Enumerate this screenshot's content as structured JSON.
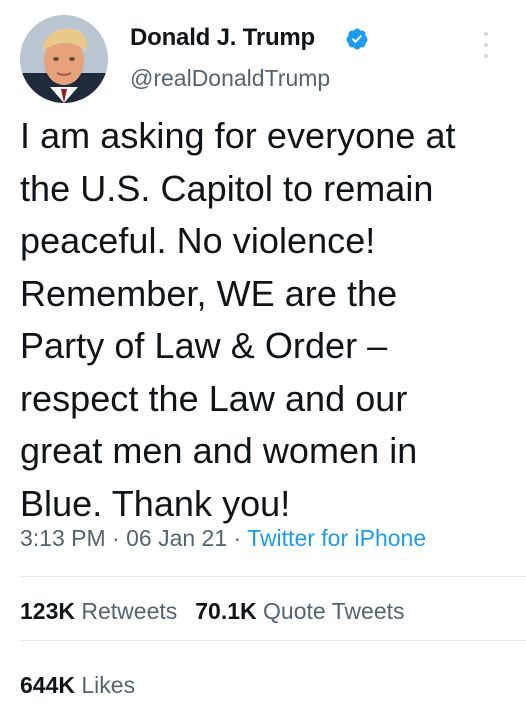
{
  "author": {
    "display_name": "Donald J. Trump",
    "handle": "@realDonaldTrump",
    "verified": true,
    "avatar_icon": "profile-photo"
  },
  "tweet": {
    "lines": [
      "I am asking for everyone at",
      "the U.S. Capitol to remain",
      "peaceful. No violence!",
      "Remember, WE are the",
      "Party of Law & Order –",
      "respect the Law and our",
      "great men and women in",
      "Blue. Thank you!"
    ]
  },
  "meta": {
    "time": "3:13 PM",
    "separator": " · ",
    "date": "06 Jan 21",
    "source": "Twitter for iPhone"
  },
  "stats": {
    "retweets_count": "123K",
    "retweets_label": "Retweets",
    "quotes_count": "70.1K",
    "quotes_label": "Quote Tweets",
    "likes_count": "644K",
    "likes_label": "Likes"
  },
  "colors": {
    "text": "#0f1419",
    "secondary": "#536471",
    "accent": "#1d9bf0",
    "divider": "#e6ecf0"
  }
}
